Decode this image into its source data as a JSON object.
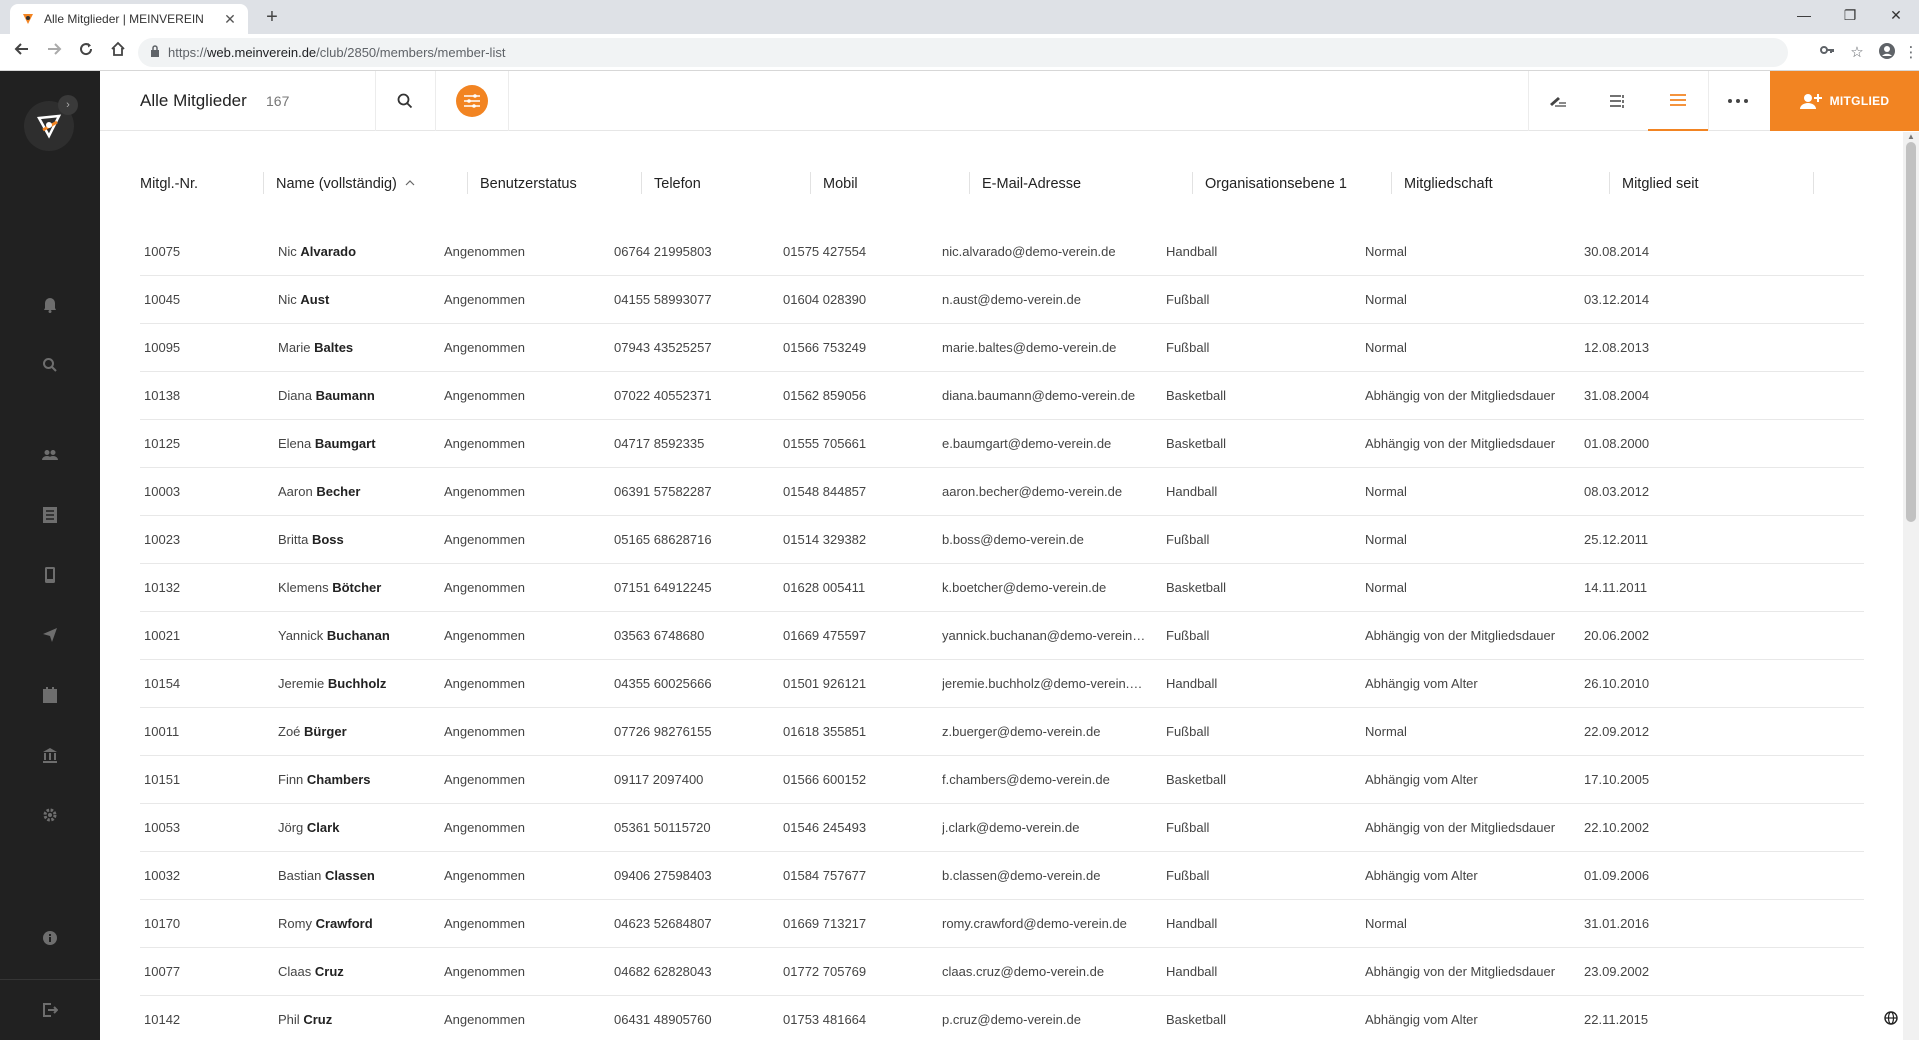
{
  "browser": {
    "tab_title": "Alle Mitglieder | MEINVEREIN",
    "tab_close": "✕",
    "new_tab": "+",
    "url_scheme": "https://",
    "url_host": "web.meinverein.de",
    "url_path": "/club/2850/members/member-list",
    "minimize": "—",
    "maximize": "❐",
    "close": "✕"
  },
  "appbar": {
    "title": "Alle Mitglieder",
    "count": "167",
    "add_member_label": "MITGLIED"
  },
  "colors": {
    "accent": "#f28422",
    "sidebar": "#212121"
  },
  "table": {
    "columns": [
      "Mitgl.-Nr.",
      "Name (vollständig)",
      "Benutzerstatus",
      "Telefon",
      "Mobil",
      "E-Mail-Adresse",
      "Organisationsebene 1",
      "Mitgliedschaft",
      "Mitglied seit"
    ],
    "sort_indicator": "^",
    "rows": [
      {
        "nr": "10075",
        "first": "Nic",
        "last": "Alvarado",
        "status": "Angenommen",
        "phone": "06764 21995803",
        "mobile": "01575 427554",
        "email": "nic.alvarado@demo-verein.de",
        "org": "Handball",
        "membership": "Normal",
        "since": "30.08.2014"
      },
      {
        "nr": "10045",
        "first": "Nic",
        "last": "Aust",
        "status": "Angenommen",
        "phone": "04155 58993077",
        "mobile": "01604 028390",
        "email": "n.aust@demo-verein.de",
        "org": "Fußball",
        "membership": "Normal",
        "since": "03.12.2014"
      },
      {
        "nr": "10095",
        "first": "Marie",
        "last": "Baltes",
        "status": "Angenommen",
        "phone": "07943 43525257",
        "mobile": "01566 753249",
        "email": "marie.baltes@demo-verein.de",
        "org": "Fußball",
        "membership": "Normal",
        "since": "12.08.2013"
      },
      {
        "nr": "10138",
        "first": "Diana",
        "last": "Baumann",
        "status": "Angenommen",
        "phone": "07022 40552371",
        "mobile": "01562 859056",
        "email": "diana.baumann@demo-verein.de",
        "org": "Basketball",
        "membership": "Abhängig von der Mitgliedsdauer",
        "since": "31.08.2004"
      },
      {
        "nr": "10125",
        "first": "Elena",
        "last": "Baumgart",
        "status": "Angenommen",
        "phone": "04717 8592335",
        "mobile": "01555 705661",
        "email": "e.baumgart@demo-verein.de",
        "org": "Basketball",
        "membership": "Abhängig von der Mitgliedsdauer",
        "since": "01.08.2000"
      },
      {
        "nr": "10003",
        "first": "Aaron",
        "last": "Becher",
        "status": "Angenommen",
        "phone": "06391 57582287",
        "mobile": "01548 844857",
        "email": "aaron.becher@demo-verein.de",
        "org": "Handball",
        "membership": "Normal",
        "since": "08.03.2012"
      },
      {
        "nr": "10023",
        "first": "Britta",
        "last": "Boss",
        "status": "Angenommen",
        "phone": "05165 68628716",
        "mobile": "01514 329382",
        "email": "b.boss@demo-verein.de",
        "org": "Fußball",
        "membership": "Normal",
        "since": "25.12.2011"
      },
      {
        "nr": "10132",
        "first": "Klemens",
        "last": "Bötcher",
        "status": "Angenommen",
        "phone": "07151 64912245",
        "mobile": "01628 005411",
        "email": "k.boetcher@demo-verein.de",
        "org": "Basketball",
        "membership": "Normal",
        "since": "14.11.2011"
      },
      {
        "nr": "10021",
        "first": "Yannick",
        "last": "Buchanan",
        "status": "Angenommen",
        "phone": "03563 6748680",
        "mobile": "01669 475597",
        "email": "yannick.buchanan@demo-verein…",
        "org": "Fußball",
        "membership": "Abhängig von der Mitgliedsdauer",
        "since": "20.06.2002"
      },
      {
        "nr": "10154",
        "first": "Jeremie",
        "last": "Buchholz",
        "status": "Angenommen",
        "phone": "04355 60025666",
        "mobile": "01501 926121",
        "email": "jeremie.buchholz@demo-verein.…",
        "org": "Handball",
        "membership": "Abhängig vom Alter",
        "since": "26.10.2010"
      },
      {
        "nr": "10011",
        "first": "Zoé",
        "last": "Bürger",
        "status": "Angenommen",
        "phone": "07726 98276155",
        "mobile": "01618 355851",
        "email": "z.buerger@demo-verein.de",
        "org": "Fußball",
        "membership": "Normal",
        "since": "22.09.2012"
      },
      {
        "nr": "10151",
        "first": "Finn",
        "last": "Chambers",
        "status": "Angenommen",
        "phone": "09117 2097400",
        "mobile": "01566 600152",
        "email": "f.chambers@demo-verein.de",
        "org": "Basketball",
        "membership": "Abhängig vom Alter",
        "since": "17.10.2005"
      },
      {
        "nr": "10053",
        "first": "Jörg",
        "last": "Clark",
        "status": "Angenommen",
        "phone": "05361 50115720",
        "mobile": "01546 245493",
        "email": "j.clark@demo-verein.de",
        "org": "Fußball",
        "membership": "Abhängig von der Mitgliedsdauer",
        "since": "22.10.2002"
      },
      {
        "nr": "10032",
        "first": "Bastian",
        "last": "Classen",
        "status": "Angenommen",
        "phone": "09406 27598403",
        "mobile": "01584 757677",
        "email": "b.classen@demo-verein.de",
        "org": "Fußball",
        "membership": "Abhängig vom Alter",
        "since": "01.09.2006"
      },
      {
        "nr": "10170",
        "first": "Romy",
        "last": "Crawford",
        "status": "Angenommen",
        "phone": "04623 52684807",
        "mobile": "01669 713217",
        "email": "romy.crawford@demo-verein.de",
        "org": "Handball",
        "membership": "Normal",
        "since": "31.01.2016"
      },
      {
        "nr": "10077",
        "first": "Claas",
        "last": "Cruz",
        "status": "Angenommen",
        "phone": "04682 62828043",
        "mobile": "01772 705769",
        "email": "claas.cruz@demo-verein.de",
        "org": "Handball",
        "membership": "Abhängig von der Mitgliedsdauer",
        "since": "23.09.2002"
      },
      {
        "nr": "10142",
        "first": "Phil",
        "last": "Cruz",
        "status": "Angenommen",
        "phone": "06431 48905760",
        "mobile": "01753 481664",
        "email": "p.cruz@demo-verein.de",
        "org": "Basketball",
        "membership": "Abhängig vom Alter",
        "since": "22.11.2015"
      }
    ]
  }
}
